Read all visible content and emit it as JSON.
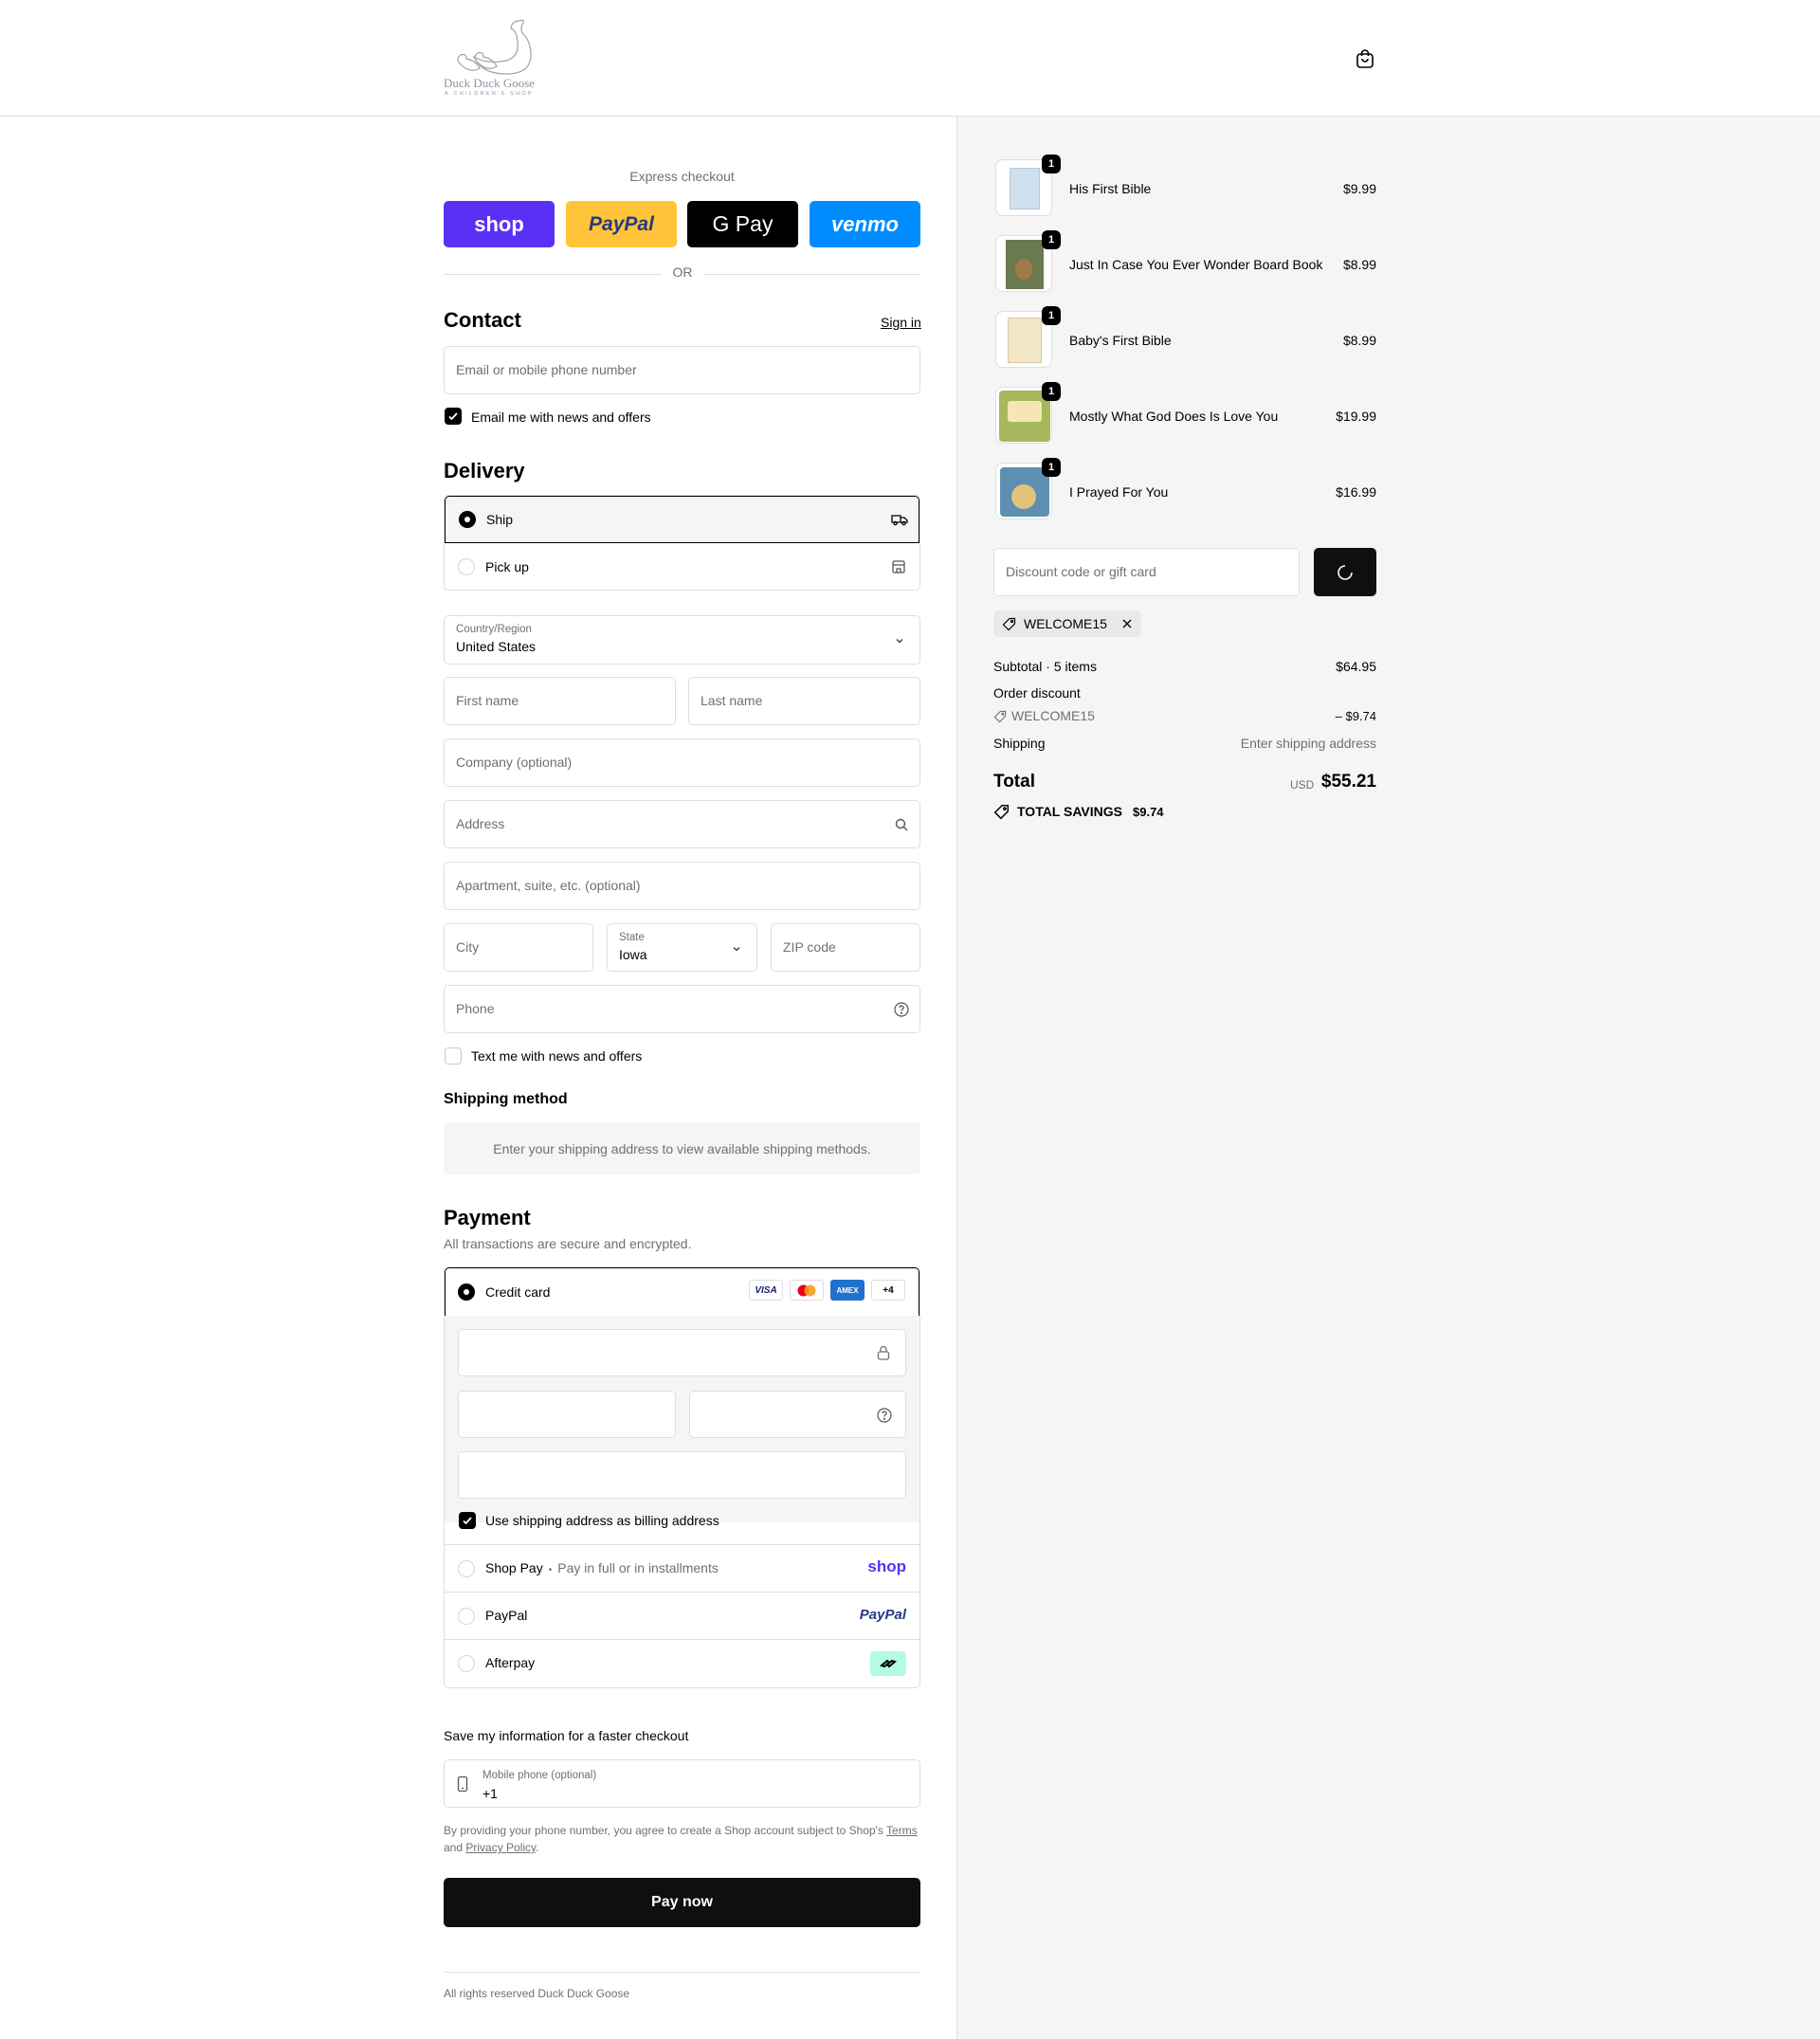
{
  "brand": {
    "name_line1": "Duck Duck Goose",
    "name_line2": "A CHILDREN'S SHOP"
  },
  "express": {
    "title": "Express checkout",
    "buttons": [
      {
        "label": "shop",
        "color": "#5a31f4"
      },
      {
        "label": "PayPal",
        "color": "#ffc439"
      },
      {
        "label": "G Pay",
        "color": "#000000"
      },
      {
        "label": "venmo",
        "color": "#008cff"
      }
    ],
    "or": "OR"
  },
  "contact": {
    "heading": "Contact",
    "sign_in": "Sign in",
    "email_placeholder": "Email or mobile phone number",
    "news_label": "Email me with news and offers",
    "news_checked": true
  },
  "delivery": {
    "heading": "Delivery",
    "options": [
      {
        "label": "Ship",
        "selected": true
      },
      {
        "label": "Pick up",
        "selected": false
      }
    ],
    "country_label": "Country/Region",
    "country_value": "United States",
    "first_name": "First name",
    "last_name": "Last name",
    "company": "Company (optional)",
    "address": "Address",
    "apartment": "Apartment, suite, etc. (optional)",
    "city": "City",
    "state_label": "State",
    "state_value": "Iowa",
    "zip": "ZIP code",
    "phone": "Phone",
    "text_label": "Text me with news and offers",
    "text_checked": false
  },
  "shipping_method": {
    "heading": "Shipping method",
    "notice": "Enter your shipping address to view available shipping methods."
  },
  "payment": {
    "heading": "Payment",
    "subheading": "All transactions are secure and encrypted.",
    "credit_card": "Credit card",
    "card_brands": [
      "VISA",
      "Mastercard",
      "AMEX"
    ],
    "more_brands": "+4",
    "billing_label": "Use shipping address as billing address",
    "billing_checked": true,
    "shop_pay": "Shop Pay",
    "shop_pay_sub": "Pay in full or in installments",
    "shop_pay_logo": "shop",
    "paypal": "PayPal",
    "paypal_logo": "PayPal",
    "afterpay": "Afterpay"
  },
  "save_info": {
    "heading": "Save my information for a faster checkout",
    "mobile_label": "Mobile phone (optional)",
    "mobile_value": "+1",
    "legal_prefix": "By providing your phone number, you agree to create a Shop account subject to Shop's",
    "terms": "Terms",
    "and": "and",
    "privacy": "Privacy Policy",
    "period": "."
  },
  "pay_now": "Pay now",
  "footer": "All rights reserved Duck Duck Goose",
  "cart": {
    "items": [
      {
        "name": "His First Bible",
        "price": "$9.99",
        "qty": "1",
        "color": "#cfe0ee"
      },
      {
        "name": "Just In Case You Ever Wonder Board Book",
        "price": "$8.99",
        "qty": "1",
        "color": "#6a7a4e"
      },
      {
        "name": "Baby's First Bible",
        "price": "$8.99",
        "qty": "1",
        "color": "#f1e6c6"
      },
      {
        "name": "Mostly What God Does Is Love You",
        "price": "$19.99",
        "qty": "1",
        "color": "#a7b85c"
      },
      {
        "name": "I Prayed For You",
        "price": "$16.99",
        "qty": "1",
        "color": "#5d8fb0"
      }
    ],
    "discount_placeholder": "Discount code or gift card",
    "discount_tag": "WELCOME15",
    "subtotal_label": "Subtotal · 5 items",
    "subtotal_value": "$64.95",
    "order_discount_label": "Order discount",
    "order_discount_code": "WELCOME15",
    "order_discount_value": "– $9.74",
    "shipping_label": "Shipping",
    "shipping_value": "Enter shipping address",
    "total_label": "Total",
    "currency": "USD",
    "total_value": "$55.21",
    "savings_label": "TOTAL SAVINGS",
    "savings_value": "$9.74"
  }
}
